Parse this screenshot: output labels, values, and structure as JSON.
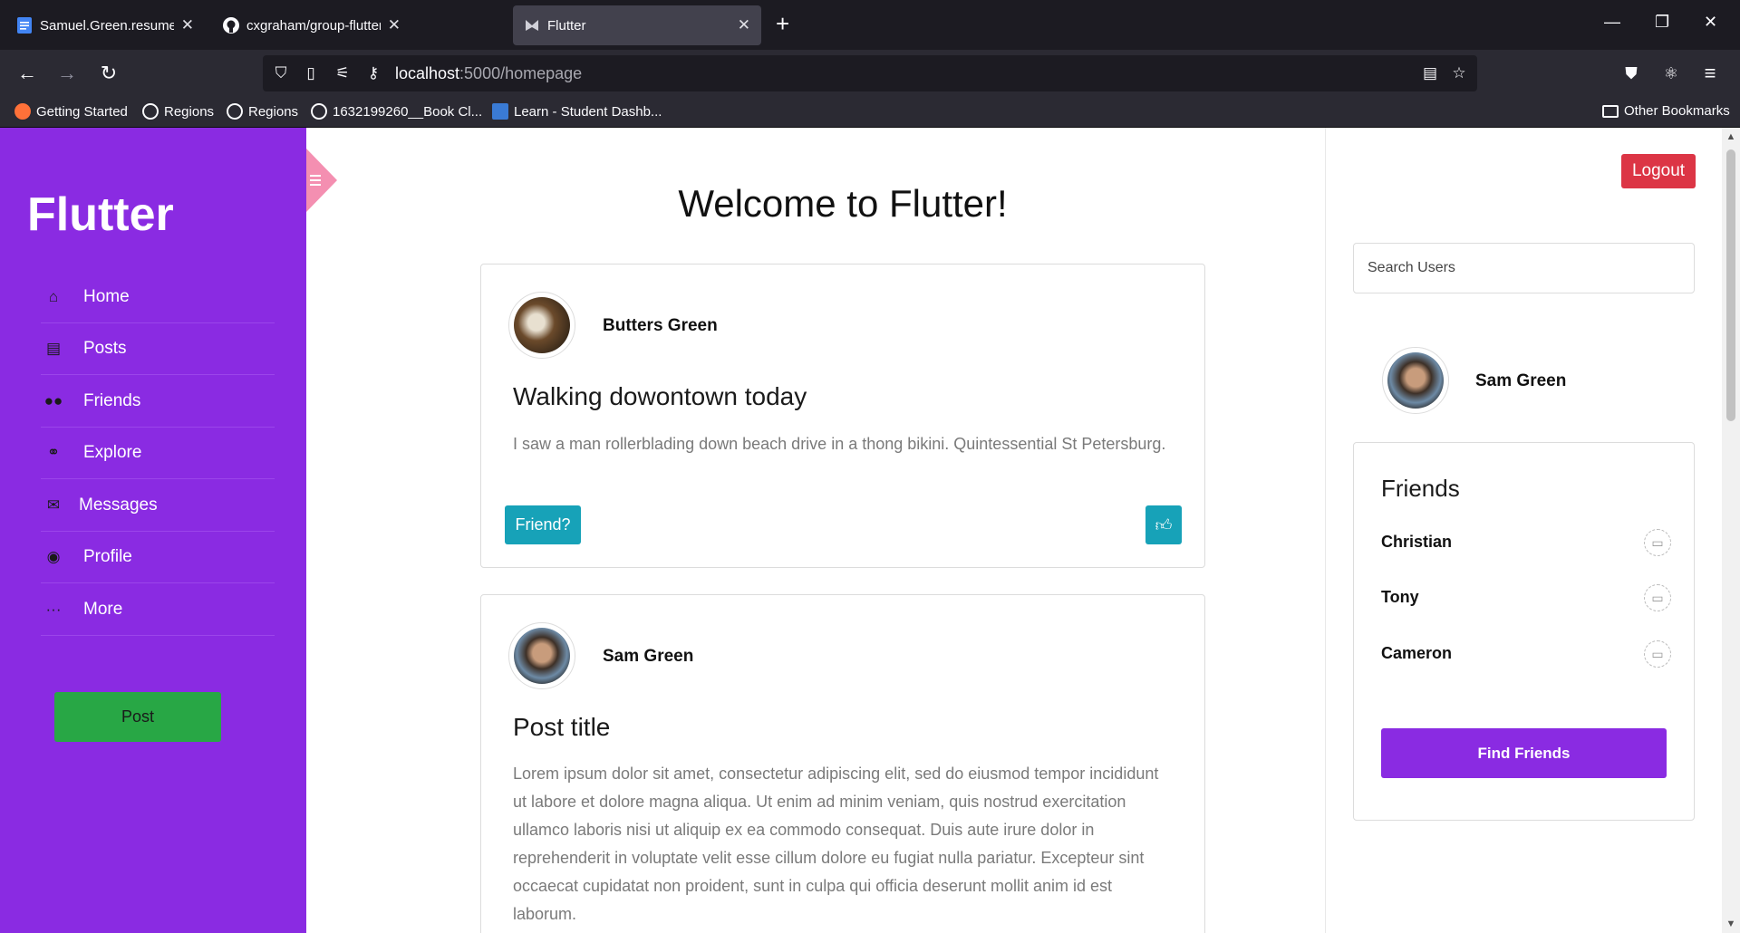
{
  "browser": {
    "tabs": [
      {
        "title": "Samuel.Green.resume_duy edits",
        "icon": "docs-icon",
        "active": false
      },
      {
        "title": "cxgraham/group-flutter: Social",
        "icon": "github-icon",
        "active": false
      },
      {
        "title": "Flutter",
        "icon": "flutter-favicon",
        "active": true
      }
    ],
    "url_host": "localhost",
    "url_path": ":5000/homepage",
    "bookmarks": [
      {
        "label": "Getting Started",
        "icon": "firefox-icon"
      },
      {
        "label": "Regions",
        "icon": "globe-icon"
      },
      {
        "label": "Regions",
        "icon": "globe-icon"
      },
      {
        "label": "1632199260__Book Cl...",
        "icon": "globe-icon"
      },
      {
        "label": "Learn - Student Dashb...",
        "icon": "learn-icon"
      }
    ],
    "other_bookmarks": "Other Bookmarks"
  },
  "sidebar": {
    "brand": "Flutter",
    "items": [
      {
        "label": "Home",
        "icon": "home-icon"
      },
      {
        "label": "Posts",
        "icon": "posts-icon"
      },
      {
        "label": "Friends",
        "icon": "friends-icon"
      },
      {
        "label": "Explore",
        "icon": "binoculars-icon"
      },
      {
        "label": "Messages",
        "icon": "envelope-icon"
      },
      {
        "label": "Profile",
        "icon": "user-circle-icon"
      },
      {
        "label": "More",
        "icon": "more-icon"
      }
    ],
    "post_button": "Post",
    "color": "#8a2be2"
  },
  "main": {
    "title": "Welcome to Flutter!",
    "posts": [
      {
        "author": "Butters Green",
        "title": "Walking dowontown today",
        "body": "I saw a man rollerblading down beach drive in a thong bikini. Quintessential St Petersburg.",
        "friend_button": "Friend?"
      },
      {
        "author": "Sam Green",
        "title": "Post title",
        "body": "Lorem ipsum dolor sit amet, consectetur adipiscing elit, sed do eiusmod tempor incididunt ut labore et dolore magna aliqua. Ut enim ad minim veniam, quis nostrud exercitation ullamco laboris nisi ut aliquip ex ea commodo consequat. Duis aute irure dolor in reprehenderit in voluptate velit esse cillum dolore eu fugiat nulla pariatur. Excepteur sint occaecat cupidatat non proident, sunt in culpa qui officia deserunt mollit anim id est laborum."
      }
    ]
  },
  "right": {
    "logout": "Logout",
    "search_placeholder": "Search Users",
    "user_name": "Sam Green",
    "friends_title": "Friends",
    "friends": [
      "Christian",
      "Tony",
      "Cameron"
    ],
    "find_friends": "Find Friends"
  },
  "colors": {
    "accent": "#8a2be2",
    "success": "#28a745",
    "danger": "#dc3545",
    "info": "#17a2b8"
  }
}
